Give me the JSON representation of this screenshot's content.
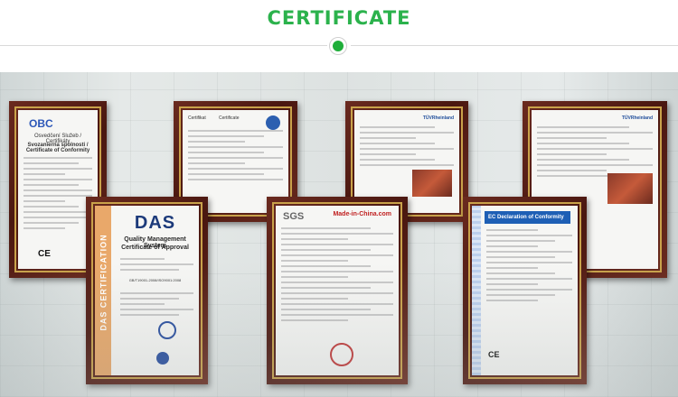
{
  "header": {
    "title": "CERTIFICATE"
  },
  "certificates": {
    "obc": {
      "logo": "OBC",
      "title": "Osvedčení Služeb / Certifikáty",
      "subtitle": "Svozanierna spolnosti / Certificate of Conformity",
      "mark": "CE"
    },
    "cert2": {
      "left_word": "Certifikat",
      "right_word": "Certificate"
    },
    "tuv1": {
      "brand": "TÜVRheinland"
    },
    "tuv2": {
      "brand": "TÜVRheinland"
    },
    "das": {
      "logo": "DAS",
      "side": "DAS CERTIFICATION",
      "title": "Quality Management System",
      "subtitle": "Certificate of Approval",
      "code": "GB/T19001-2008/ISO9001:2008"
    },
    "sgs": {
      "logo": "SGS",
      "partner": "Made-in-China.com"
    },
    "ec": {
      "title": "EC Declaration of Conformity",
      "mark": "CE"
    }
  },
  "colors": {
    "accent": "#2bb24c",
    "frame": "#4a1710",
    "gold": "#c9a24a"
  }
}
